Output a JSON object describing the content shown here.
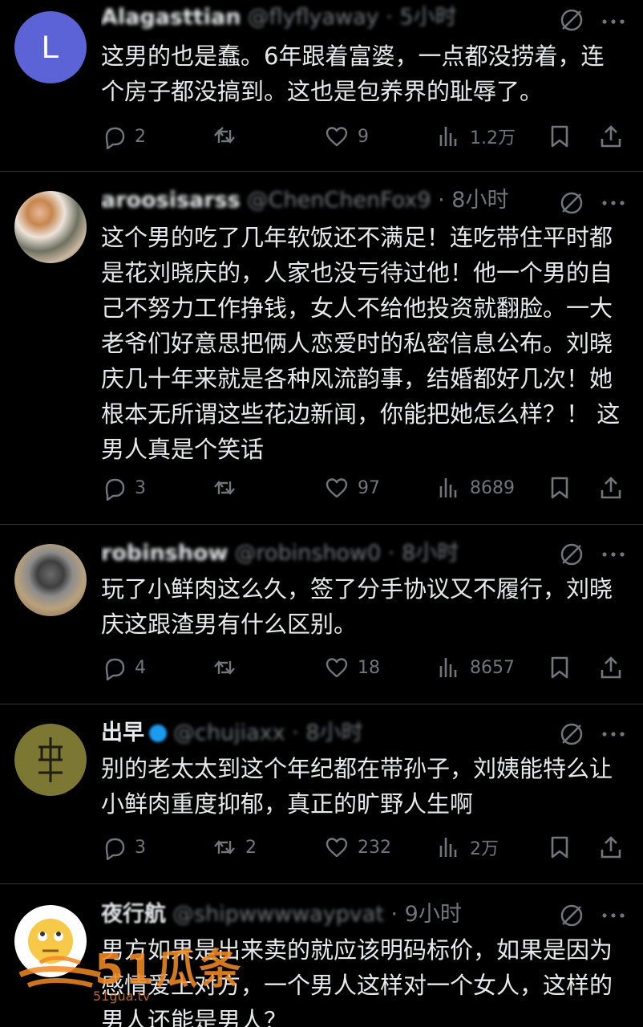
{
  "posts": [
    {
      "avatar_letter": "L",
      "avatar_color": "#5b63d6",
      "display_name": "Alagasttian",
      "handle": "@flyflyaway · 5小时",
      "time": "",
      "text": "这男的也是蠢。6年跟着富婆，一点都没捞着，连个房子都没搞到。这也是包养界的耻辱了。",
      "replies": "2",
      "reposts": "",
      "likes": "9",
      "views": "1.2万"
    },
    {
      "display_name": "aroosisarss",
      "handle": "@ChenChenFox9",
      "time": " · 8小时",
      "text": "这个男的吃了几年软饭还不满足！连吃带住平时都是花刘晓庆的，人家也没亏待过他！他一个男的自己不努力工作挣钱，女人不给他投资就翻脸。一大老爷们好意思把俩人恋爱时的私密信息公布。刘晓庆几十年来就是各种风流韵事，结婚都好几次！她根本无所谓这些花边新闻，你能把她怎么样？！ 这男人真是个笑话",
      "replies": "3",
      "reposts": "",
      "likes": "97",
      "views": "8689"
    },
    {
      "display_name": "robinshow",
      "handle": "@robinshow0 · 8小时",
      "time": "",
      "text": "玩了小鲜肉这么久，签了分手协议又不履行，刘晓庆这跟渣男有什么区别。",
      "replies": "4",
      "reposts": "",
      "likes": "18",
      "views": "8657"
    },
    {
      "display_name": "出早",
      "handle": "@chujiaxx · 8小时",
      "time": "",
      "text": "别的老太太到这个年纪都在带孙子，刘姨能特么让小鲜肉重度抑郁，真正的旷野人生啊",
      "replies": "3",
      "reposts": "2",
      "likes": "232",
      "views": "2万"
    },
    {
      "display_name": "夜行航",
      "handle": "@shipwwwwaypvat",
      "time": " · 9小时",
      "text": "男方如果是出来卖的就应该明码标价，如果是因为感情爱上对方，一个男人这样对一个女人，这样的男人还能是男人？",
      "replies": "",
      "reposts": "",
      "likes": "",
      "views": ""
    }
  ],
  "watermark": {
    "brand": "51瓜条",
    "url": "51gua.tv",
    "color": "#f08a24"
  },
  "colors": {
    "background": "#000000",
    "text": "#e7e9ea",
    "muted": "#71767b",
    "divider": "#2f3336"
  }
}
